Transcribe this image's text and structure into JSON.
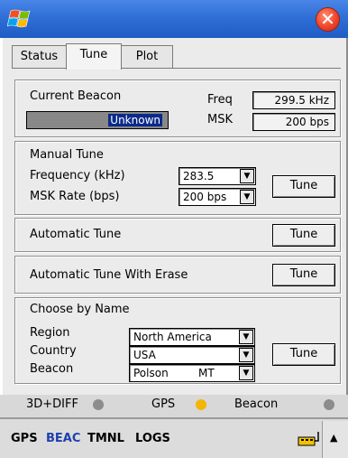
{
  "tabs": [
    "Status",
    "Tune",
    "Plot"
  ],
  "current_beacon": {
    "heading": "Current Beacon",
    "beacon_value": "Unknown",
    "freq_label": "Freq",
    "freq_value": "299.5 kHz",
    "msk_label": "MSK",
    "msk_value": "200 bps"
  },
  "manual_tune": {
    "heading": "Manual Tune",
    "frequency_label": "Frequency (kHz)",
    "frequency_value": "283.5",
    "msk_rate_label": "MSK Rate (bps)",
    "msk_rate_value": "200 bps",
    "tune_button": "Tune"
  },
  "automatic_tune": {
    "label": "Automatic Tune",
    "tune_button": "Tune"
  },
  "automatic_tune_erase": {
    "label": "Automatic Tune With Erase",
    "tune_button": "Tune"
  },
  "choose_by_name": {
    "heading": "Choose by Name",
    "region_label": "Region",
    "region_value": "North America",
    "country_label": "Country",
    "country_value": "USA",
    "beacon_label": "Beacon",
    "beacon_name": "Polson",
    "beacon_state": "MT",
    "tune_button": "Tune"
  },
  "status_indicators": [
    {
      "label": "3D+DIFF",
      "color": "#8c8c8c"
    },
    {
      "label": "GPS",
      "color": "#f2b705"
    },
    {
      "label": "Beacon",
      "color": "#8c8c8c"
    }
  ],
  "taskbar": {
    "items": [
      {
        "label": "GPS",
        "color": "#000000"
      },
      {
        "label": "BEAC",
        "color": "#1f3fae"
      },
      {
        "label": "TMNL",
        "color": "#000000"
      },
      {
        "label": "LOGS",
        "color": "#000000"
      }
    ],
    "scroll_up": "▲"
  },
  "colors": {
    "title_bar": "#2f6fd6",
    "close_button": "#f0442a",
    "gps_indicator": "#f2b705"
  },
  "icons": {
    "window_logo": "windows-logo-icon",
    "close": "close-icon",
    "keyboard": "keyboard-lock-icon"
  }
}
